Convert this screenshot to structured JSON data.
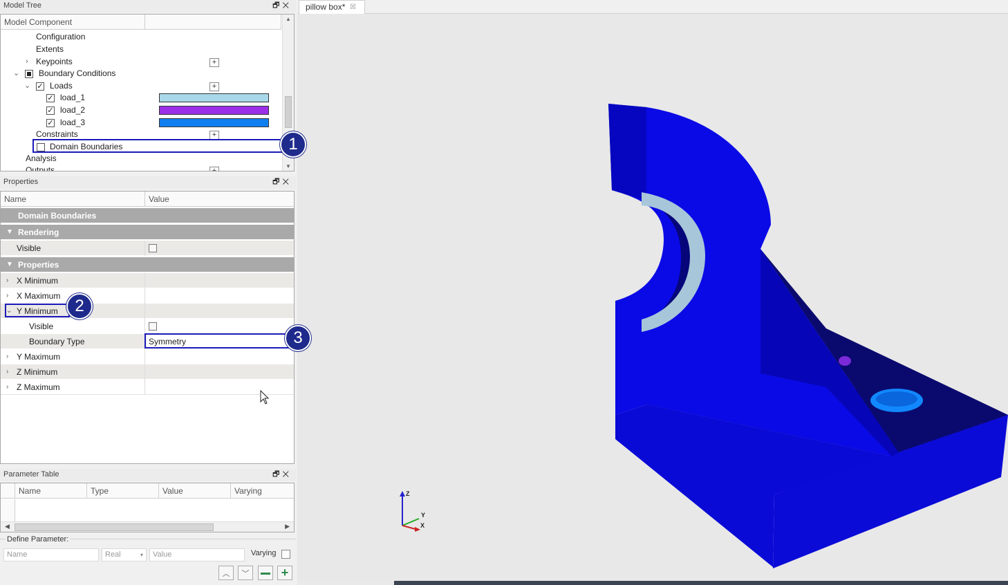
{
  "model_tree": {
    "title": "Model Tree",
    "col_component": "Model Component",
    "items": {
      "configuration": "Configuration",
      "extents": "Extents",
      "keypoints": "Keypoints",
      "boundary_conditions": "Boundary Conditions",
      "loads": "Loads",
      "load_1": "load_1",
      "load_2": "load_2",
      "load_3": "load_3",
      "constraints": "Constraints",
      "domain_boundaries": "Domain Boundaries",
      "analysis": "Analysis",
      "outputs": "Outputs"
    },
    "load_colors": {
      "load_1": "#a8d8ea",
      "load_2": "#9b30e8",
      "load_3": "#1080f0"
    }
  },
  "properties": {
    "title": "Properties",
    "col_name": "Name",
    "col_value": "Value",
    "header": "Domain Boundaries",
    "rendering": "Rendering",
    "visible": "Visible",
    "properties_cat": "Properties",
    "x_minimum": "X Minimum",
    "x_maximum": "X Maximum",
    "y_minimum": "Y Minimum",
    "sub_visible": "Visible",
    "boundary_type": "Boundary Type",
    "boundary_type_value": "Symmetry",
    "y_maximum": "Y Maximum",
    "z_minimum": "Z Minimum",
    "z_maximum": "Z Maximum"
  },
  "parameter_table": {
    "title": "Parameter Table",
    "columns": [
      "Name",
      "Type",
      "Value",
      "Varying"
    ],
    "define_label": "Define Parameter:",
    "name_placeholder": "Name",
    "type_value": "Real",
    "value_placeholder": "Value",
    "varying_label": "Varying"
  },
  "viewport": {
    "tab_label": "pillow box*",
    "axes": {
      "z": "Z",
      "y": "Y",
      "x": "X"
    }
  },
  "callouts": [
    "1",
    "2",
    "3"
  ]
}
